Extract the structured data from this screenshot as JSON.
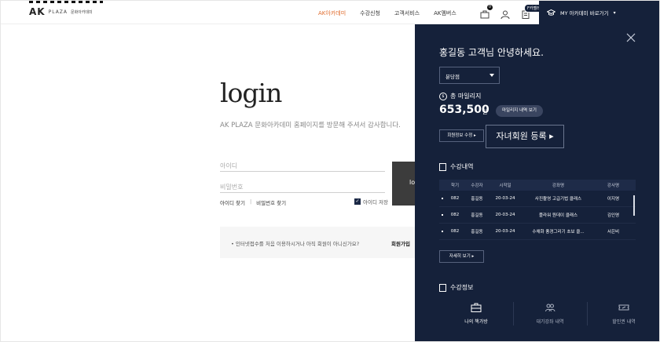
{
  "header": {
    "logo": {
      "ak": "AK",
      "plaza": "PLAZA",
      "sub": "문화아카데미"
    },
    "nav": [
      {
        "label": "AK아카데미",
        "active": true
      },
      {
        "label": "수강신청",
        "active": false
      },
      {
        "label": "고객서비스",
        "active": false
      },
      {
        "label": "AK멤버스",
        "active": false
      }
    ],
    "cart_badge": "0",
    "tag": "F카멜레고",
    "my_academy": "MY 아카데미 바로가기"
  },
  "login": {
    "title": "login",
    "desc": "AK PLAZA 문화아카데미 홈페이지를 방문해 주셔서 감사합니다.",
    "id_placeholder": "아이디",
    "pw_placeholder": "비밀번호",
    "login_btn": "lo",
    "find_id": "아이디 찾기",
    "find_pw": "비밀번호 찾기",
    "save_id": "아이디 저장",
    "notice": "인터넷접수를 처음 이용하시거나 아직 회원이 아니신가요?",
    "join": "회원가입"
  },
  "panel": {
    "greeting": "홍길동 고객님 안녕하세요.",
    "branch": "분당점",
    "mileage_label": "총 마일리지",
    "mileage_value": "653,500",
    "mileage_unit": "원",
    "mileage_btn": "마일리지 내역 보기",
    "edit_btn": "회원정보 수정 ▸",
    "child_btn": "자녀회원 등록 ▸",
    "course_title": "수강내역",
    "columns": [
      "학기",
      "수강자",
      "시작일",
      "강좌명",
      "강사명"
    ],
    "rows": [
      {
        "term": "082",
        "student": "홍길동",
        "start": "20-03-24",
        "course": "사진촬영 고급기법 클래스",
        "teacher": "이지영"
      },
      {
        "term": "082",
        "student": "홍길동",
        "start": "20-03-24",
        "course": "플라워 원데이 클래스",
        "teacher": "김인영"
      },
      {
        "term": "082",
        "student": "홍길동",
        "start": "20-03-24",
        "course": "수채화 풍경그리기 초보 클...",
        "teacher": "서은비"
      }
    ],
    "more_btn": "자세히 보기 ▸",
    "info_title": "수강정보",
    "quick": [
      "나의 책가방",
      "대기강좌 내역",
      "할인권 내역"
    ]
  }
}
